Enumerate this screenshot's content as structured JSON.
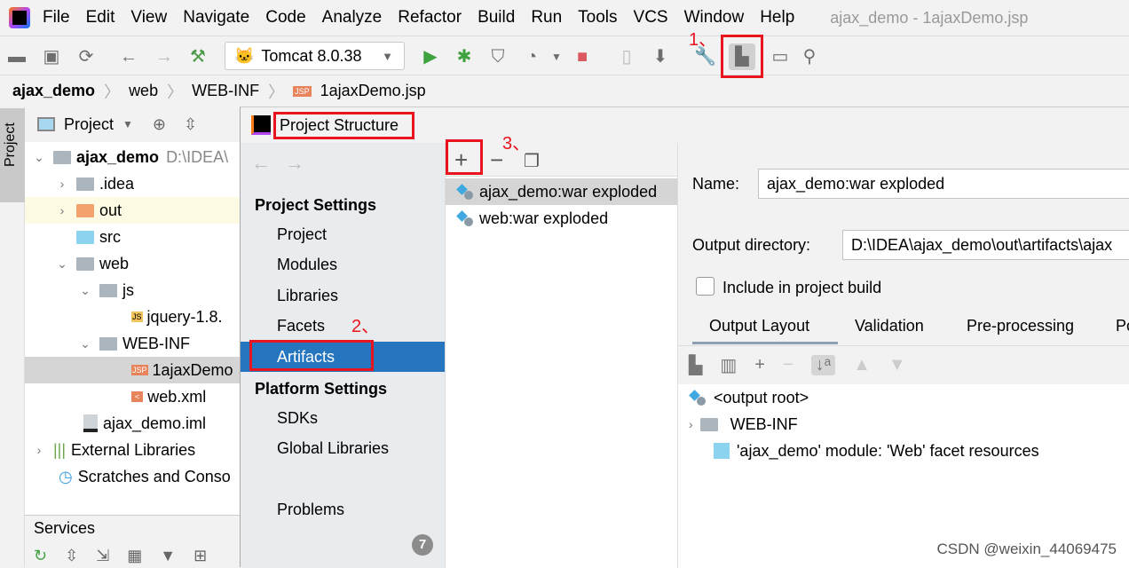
{
  "menu": {
    "items": [
      "File",
      "Edit",
      "View",
      "Navigate",
      "Code",
      "Analyze",
      "Refactor",
      "Build",
      "Run",
      "Tools",
      "VCS",
      "Window",
      "Help"
    ],
    "window_title": "ajax_demo - 1ajaxDemo.jsp"
  },
  "toolbar": {
    "run_config": "Tomcat 8.0.38"
  },
  "breadcrumb": [
    "ajax_demo",
    "web",
    "WEB-INF",
    "1ajaxDemo.jsp"
  ],
  "side_tab": "Project",
  "project_panel": {
    "title": "Project",
    "tree": [
      {
        "label": "ajax_demo",
        "hint": "D:\\IDEA\\"
      },
      {
        "label": ".idea"
      },
      {
        "label": "out"
      },
      {
        "label": "src"
      },
      {
        "label": "web"
      },
      {
        "label": "js"
      },
      {
        "label": "jquery-1.8."
      },
      {
        "label": "WEB-INF"
      },
      {
        "label": "1ajaxDemo"
      },
      {
        "label": "web.xml"
      },
      {
        "label": "ajax_demo.iml"
      },
      {
        "label": "External Libraries"
      },
      {
        "label": "Scratches and Conso"
      }
    ],
    "services": "Services"
  },
  "dialog": {
    "title": "Project Structure",
    "project_settings_header": "Project Settings",
    "project_settings": [
      "Project",
      "Modules",
      "Libraries",
      "Facets",
      "Artifacts"
    ],
    "platform_settings_header": "Platform Settings",
    "platform_settings": [
      "SDKs",
      "Global Libraries"
    ],
    "problems": "Problems",
    "problems_count": "7",
    "artifacts": [
      "ajax_demo:war exploded",
      "web:war exploded"
    ],
    "name_label": "Name:",
    "name_value": "ajax_demo:war exploded",
    "output_dir_label": "Output directory:",
    "output_dir_value": "D:\\IDEA\\ajax_demo\\out\\artifacts\\ajax",
    "include_label": "Include in project build",
    "tabs": [
      "Output Layout",
      "Validation",
      "Pre-processing",
      "Po"
    ],
    "layout_tree": [
      "<output root>",
      "WEB-INF",
      "'ajax_demo' module: 'Web' facet resources"
    ]
  },
  "annotations": [
    "1、",
    "2、",
    "3、"
  ],
  "watermark": "CSDN @weixin_44069475"
}
